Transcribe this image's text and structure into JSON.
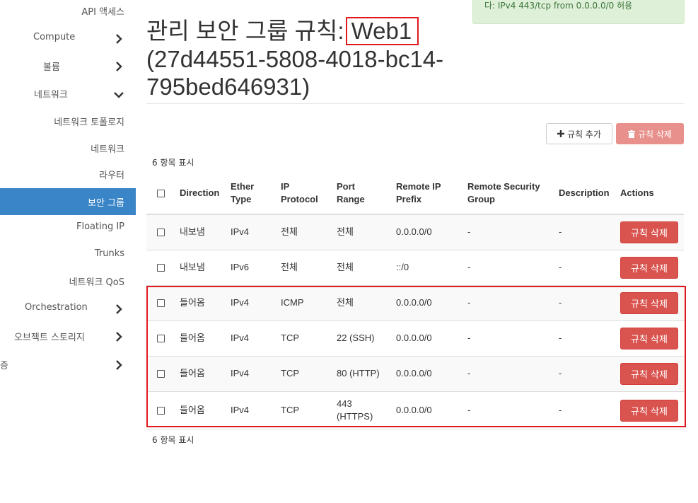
{
  "sidebar": {
    "items": [
      {
        "label": "API 액세스",
        "chevron": ""
      },
      {
        "label": "Compute",
        "chevron": "chevron-right-icon"
      },
      {
        "label": "볼륨",
        "chevron": "chevron-right-icon"
      },
      {
        "label": "네트워크",
        "chevron": "chevron-down-icon"
      },
      {
        "label": "네트워크 토폴로지",
        "chevron": ""
      },
      {
        "label": "네트워크",
        "chevron": ""
      },
      {
        "label": "라우터",
        "chevron": ""
      },
      {
        "label": "보안 그룹",
        "chevron": "",
        "active": true
      },
      {
        "label": "Floating IP",
        "chevron": ""
      },
      {
        "label": "Trunks",
        "chevron": ""
      },
      {
        "label": "네트워크 QoS",
        "chevron": ""
      },
      {
        "label": "Orchestration",
        "chevron": "chevron-right-icon"
      },
      {
        "label": "오브젝트 스토리지",
        "chevron": "chevron-right-icon"
      },
      {
        "label": "증",
        "chevron": "chevron-right-icon"
      }
    ]
  },
  "alert": {
    "text": "다: IPv4 443/tcp from 0.0.0.0/0 허용"
  },
  "page": {
    "title_prefix": "관리 보안 그룹 규칙:",
    "title_name": "Web1",
    "title_id": "(27d44551-5808-4018-bc14-795bed646931)"
  },
  "toolbar": {
    "add_label": "규칙 추가",
    "delete_label": "규칙 삭제"
  },
  "table": {
    "count_top": "6 항목 표시",
    "count_bottom": "6 항목 표시",
    "headers": {
      "direction": "Direction",
      "ether_type": "Ether Type",
      "ip_protocol": "IP Protocol",
      "port_range": "Port Range",
      "remote_ip_prefix": "Remote IP Prefix",
      "remote_sg": "Remote Security Group",
      "description": "Description",
      "actions": "Actions"
    },
    "rows": [
      {
        "direction": "내보냄",
        "ether_type": "IPv4",
        "ip_protocol": "전체",
        "port_range": "전체",
        "remote_ip_prefix": "0.0.0.0/0",
        "remote_sg": "-",
        "description": "-",
        "action": "규칙 삭제"
      },
      {
        "direction": "내보냄",
        "ether_type": "IPv6",
        "ip_protocol": "전체",
        "port_range": "전체",
        "remote_ip_prefix": "::/0",
        "remote_sg": "-",
        "description": "-",
        "action": "규칙 삭제"
      },
      {
        "direction": "들어옴",
        "ether_type": "IPv4",
        "ip_protocol": "ICMP",
        "port_range": "전체",
        "remote_ip_prefix": "0.0.0.0/0",
        "remote_sg": "-",
        "description": "-",
        "action": "규칙 삭제"
      },
      {
        "direction": "들어옴",
        "ether_type": "IPv4",
        "ip_protocol": "TCP",
        "port_range": "22 (SSH)",
        "remote_ip_prefix": "0.0.0.0/0",
        "remote_sg": "-",
        "description": "-",
        "action": "규칙 삭제"
      },
      {
        "direction": "들어옴",
        "ether_type": "IPv4",
        "ip_protocol": "TCP",
        "port_range": "80 (HTTP)",
        "remote_ip_prefix": "0.0.0.0/0",
        "remote_sg": "-",
        "description": "-",
        "action": "규칙 삭제"
      },
      {
        "direction": "들어옴",
        "ether_type": "IPv4",
        "ip_protocol": "TCP",
        "port_range": "443 (HTTPS)",
        "remote_ip_prefix": "0.0.0.0/0",
        "remote_sg": "-",
        "description": "-",
        "action": "규칙 삭제"
      }
    ]
  },
  "colors": {
    "active_nav": "#3a85c7",
    "danger": "#d9534f",
    "danger_disabled": "#e8908b",
    "highlight": "#e0191f",
    "alert_bg": "#dff0d8"
  }
}
